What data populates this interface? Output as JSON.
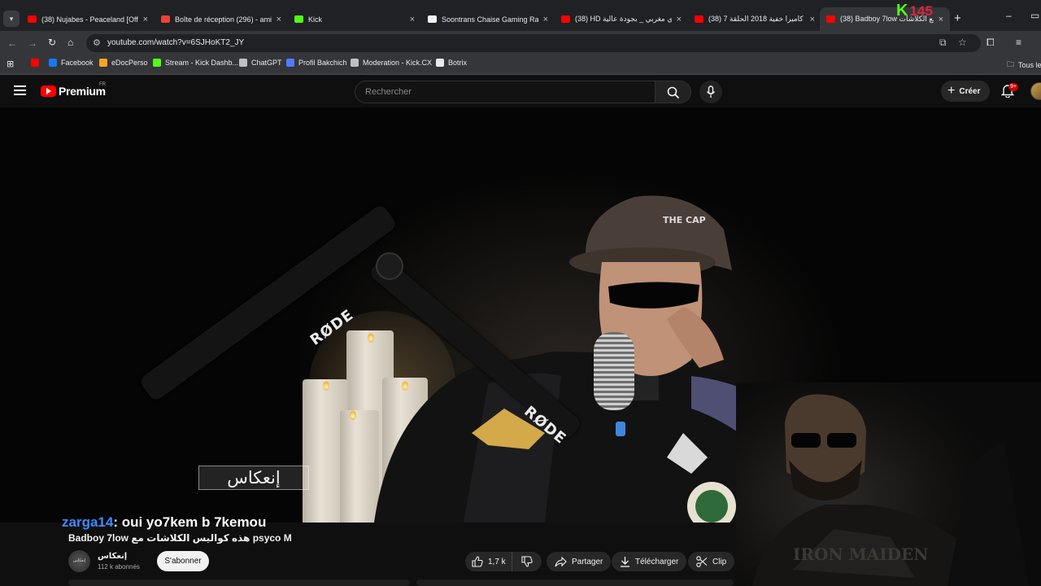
{
  "browser": {
    "tabs": [
      {
        "title": "(38) Nujabes - Peaceland [Offic",
        "favicon": "youtube",
        "color": "#ff0000"
      },
      {
        "title": "Boîte de réception (296) - amin",
        "favicon": "gmail",
        "color": "#ea4335"
      },
      {
        "title": "Kick",
        "favicon": "kick",
        "color": "#53fc18"
      },
      {
        "title": "Soontrans Chaise Gaming Racin",
        "favicon": "amazon",
        "color": "#f1f1f1"
      },
      {
        "title": "(38) HD دي مغربي _ بجودة عالية",
        "favicon": "youtube",
        "color": "#ff0000"
      },
      {
        "title": "(38) كاميرا خفية 2018 الحلقة 7 ...",
        "favicon": "youtube",
        "color": "#ff0000"
      },
      {
        "title": "(38) Badboy 7low مع الكلاشات ...",
        "favicon": "youtube",
        "color": "#ff0000",
        "active": true
      }
    ],
    "overlay_kick": {
      "letter": "K",
      "number": "145"
    },
    "url": "youtube.com/watch?v=6SJHoKT2_JY",
    "bookmarks": [
      {
        "label": "Facebook",
        "icon": "facebook-icon",
        "color": "#1877f2"
      },
      {
        "label": "eDocPerso",
        "icon": "edocperso-icon",
        "color": "#f5a623"
      },
      {
        "label": "Stream - Kick Dashb...",
        "icon": "kick-icon",
        "color": "#53fc18"
      },
      {
        "label": "ChatGPT",
        "icon": "chatgpt-icon",
        "color": "#bdc1c6"
      },
      {
        "label": "Profil Bakchich",
        "icon": "bakchich-icon",
        "color": "#4f7cff"
      },
      {
        "label": "Moderation - Kick.CX",
        "icon": "moderation-icon",
        "color": "#bdc1c6"
      },
      {
        "label": "Botrix",
        "icon": "botrix-icon",
        "color": "#e8eaed"
      }
    ],
    "all_bookmarks": "Tous le"
  },
  "youtube": {
    "brand": "Premium",
    "region": "FR",
    "search_placeholder": "Rechercher",
    "create_label": "Créer",
    "notif_badge": "9+"
  },
  "video": {
    "mic_brand": "RØDE",
    "show_logo": "إنعكاس"
  },
  "chat": {
    "user": "zarga14",
    "message": ": oui yo7kem b 7kemou"
  },
  "meta": {
    "title": "Badboy 7low هذه كواليس الكلاشات مع psyco M",
    "channel_name": "إنعكاس",
    "subscribers": "112 k abonnés",
    "subscribe_label": "S'abonner",
    "likes": "1,7 k",
    "share_label": "Partager",
    "download_label": "Télécharger",
    "clip_label": "Clip"
  }
}
